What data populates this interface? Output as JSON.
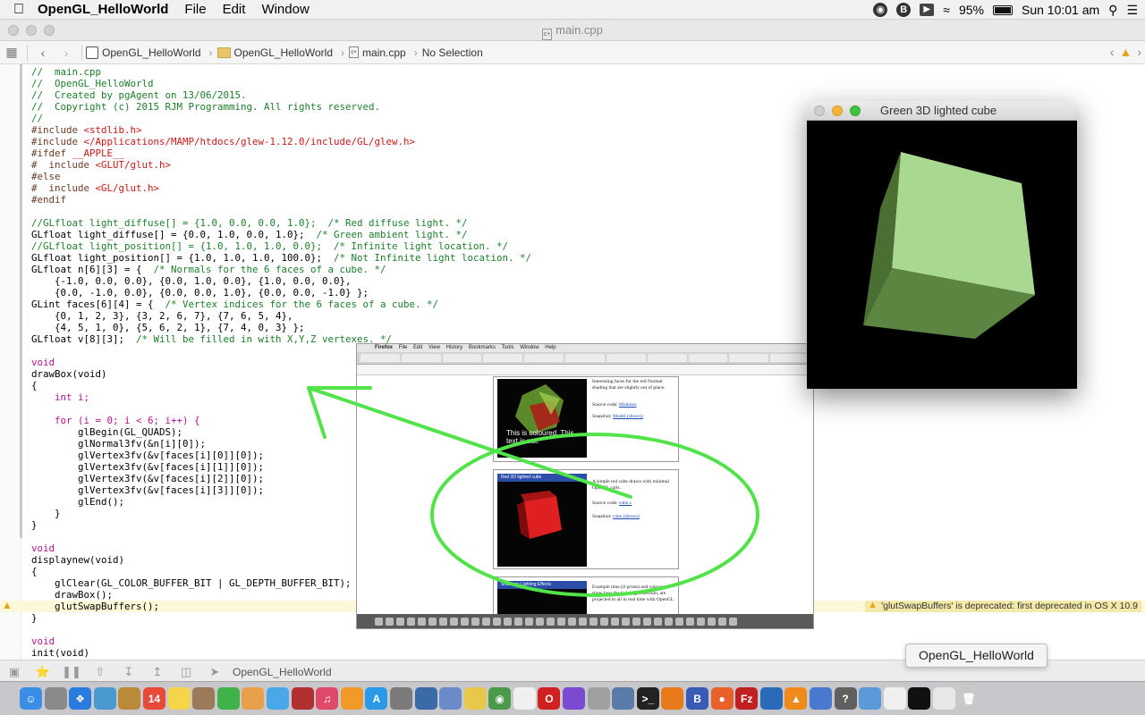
{
  "menubar": {
    "app_name": "OpenGL_HelloWorld",
    "menus": [
      "File",
      "Edit",
      "Window"
    ],
    "battery": "95%",
    "clock": "Sun 10:01 am"
  },
  "xcode": {
    "window_title": "main.cpp",
    "breadcrumb": [
      "OpenGL_HelloWorld",
      "OpenGL_HelloWorld",
      "main.cpp",
      "No Selection"
    ],
    "warning_message": "'glutSwapBuffers' is deprecated: first deprecated in OS X 10.9",
    "debug_target": "OpenGL_HelloWorld"
  },
  "code_lines": [
    "//  main.cpp",
    "//  OpenGL_HelloWorld",
    "//  Created by pgAgent on 13/06/2015.",
    "//  Copyright (c) 2015 RJM Programming. All rights reserved.",
    "//",
    "#include <stdlib.h>",
    "#include </Applications/MAMP/htdocs/glew-1.12.0/include/GL/glew.h>",
    "#ifdef __APPLE__",
    "#  include <GLUT/glut.h>",
    "#else",
    "#  include <GL/glut.h>",
    "#endif",
    "",
    "//GLfloat light_diffuse[] = {1.0, 0.0, 0.0, 1.0};  /* Red diffuse light. */",
    "GLfloat light_diffuse[] = {0.0, 1.0, 0.0, 1.0};  /* Green ambient light. */",
    "//GLfloat light_position[] = {1.0, 1.0, 1.0, 0.0};  /* Infinite light location. */",
    "GLfloat light_position[] = {1.0, 1.0, 1.0, 100.0};  /* Not Infinite light location. */",
    "GLfloat n[6][3] = {  /* Normals for the 6 faces of a cube. */",
    "    {-1.0, 0.0, 0.0}, {0.0, 1.0, 0.0}, {1.0, 0.0, 0.0},",
    "    {0.0, -1.0, 0.0}, {0.0, 0.0, 1.0}, {0.0, 0.0, -1.0} };",
    "GLint faces[6][4] = {  /* Vertex indices for the 6 faces of a cube. */",
    "    {0, 1, 2, 3}, {3, 2, 6, 7}, {7, 6, 5, 4},",
    "    {4, 5, 1, 0}, {5, 6, 2, 1}, {7, 4, 0, 3} };",
    "GLfloat v[8][3];  /* Will be filled in with X,Y,Z vertexes. */",
    "",
    "void",
    "drawBox(void)",
    "{",
    "    int i;",
    "",
    "    for (i = 0; i < 6; i++) {",
    "        glBegin(GL_QUADS);",
    "        glNormal3fv(&n[i][0]);",
    "        glVertex3fv(&v[faces[i][0]][0]);",
    "        glVertex3fv(&v[faces[i][1]][0]);",
    "        glVertex3fv(&v[faces[i][2]][0]);",
    "        glVertex3fv(&v[faces[i][3]][0]);",
    "        glEnd();",
    "    }",
    "}",
    "",
    "void",
    "displaynew(void)",
    "{",
    "    glClear(GL_COLOR_BUFFER_BIT | GL_DEPTH_BUFFER_BIT);",
    "    drawBox();",
    "    glutSwapBuffers();",
    "}",
    "",
    "void",
    "init(void)"
  ],
  "glut_window": {
    "title": "Green 3D lighted cube"
  },
  "browser_shot": {
    "menus": [
      "Firefox",
      "File",
      "Edit",
      "View",
      "History",
      "Bookmarks",
      "Tools",
      "Window",
      "Help"
    ],
    "card1_text": "Interesting faces for the red Normal shading that are slightly out of place.",
    "card1_caption": "This is coloured. This text is not.",
    "card1_source_label": "Source code:",
    "card1_source_link": "Modulus",
    "card1_snapshot_label": "Snapshot:",
    "card1_snapshot_link": "Model (shown)",
    "card2_title": "Red 3D lighted cube",
    "card2_text": "A simple red cube drawn with minimal OpenGL calls.",
    "card2_source_label": "Source code:",
    "card2_source_link": "cube.c",
    "card2_snapshot_label": "Snapshot:",
    "card2_snapshot_link": "cube (shown)",
    "card3_title": "Shadowy Lighting Effects",
    "card3_text": "Example time (if prism) and colour to show how the lighting, reflection, are projected to all in real time with OpenGL"
  },
  "tooltip": "OpenGL_HelloWorld",
  "dock_icons": [
    "finder-icon",
    "launchpad-icon",
    "safari-icon",
    "preview-icon",
    "notes-icon",
    "calendar-icon",
    "stickies-icon",
    "contacts-icon",
    "facetime-icon",
    "photos-icon",
    "messages-icon",
    "photobooth-icon",
    "itunes-icon",
    "ibooks-icon",
    "appstore-icon",
    "sysprefs-icon",
    "xcode-instruments-icon",
    "textwrangler-icon",
    "filemerge-icon",
    "chrome-icon",
    "document-icon",
    "opera-icon",
    "imovie-icon",
    "utility-icon",
    "console-icon",
    "terminal-icon",
    "blender-icon",
    "bbedit-icon",
    "firefox-icon",
    "filezilla-icon",
    "quicktime-icon",
    "vlc-icon",
    "screenshot-icon",
    "help-icon",
    "box-icon",
    "textedit-icon",
    "glut-app-icon",
    "folder-icon",
    "trash-icon"
  ],
  "colors": {
    "comment": "#1d7d2a",
    "keyword": "#b0158e",
    "string": "#c41a16",
    "cube_face": "#9fd68a",
    "annotation": "#52e24a",
    "warning": "#e8a317"
  }
}
